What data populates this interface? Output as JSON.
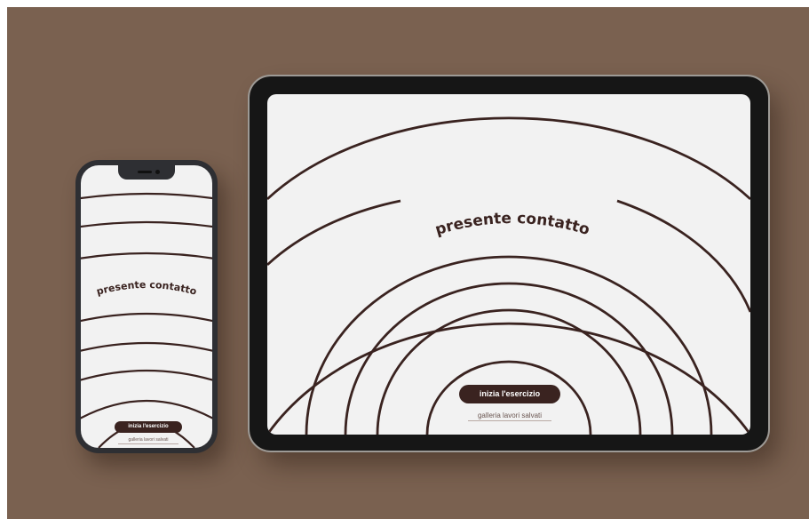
{
  "phone": {
    "title": "presente contatto",
    "start_button": "inizia l'esercizio",
    "gallery_link": "galleria lavori salvati"
  },
  "tablet": {
    "title": "presente contatto",
    "start_button": "inizia l'esercizio",
    "gallery_link": "galleria lavori salvati"
  },
  "colors": {
    "background": "#7a6150",
    "screen": "#f2f2f2",
    "accent": "#3a2320"
  }
}
